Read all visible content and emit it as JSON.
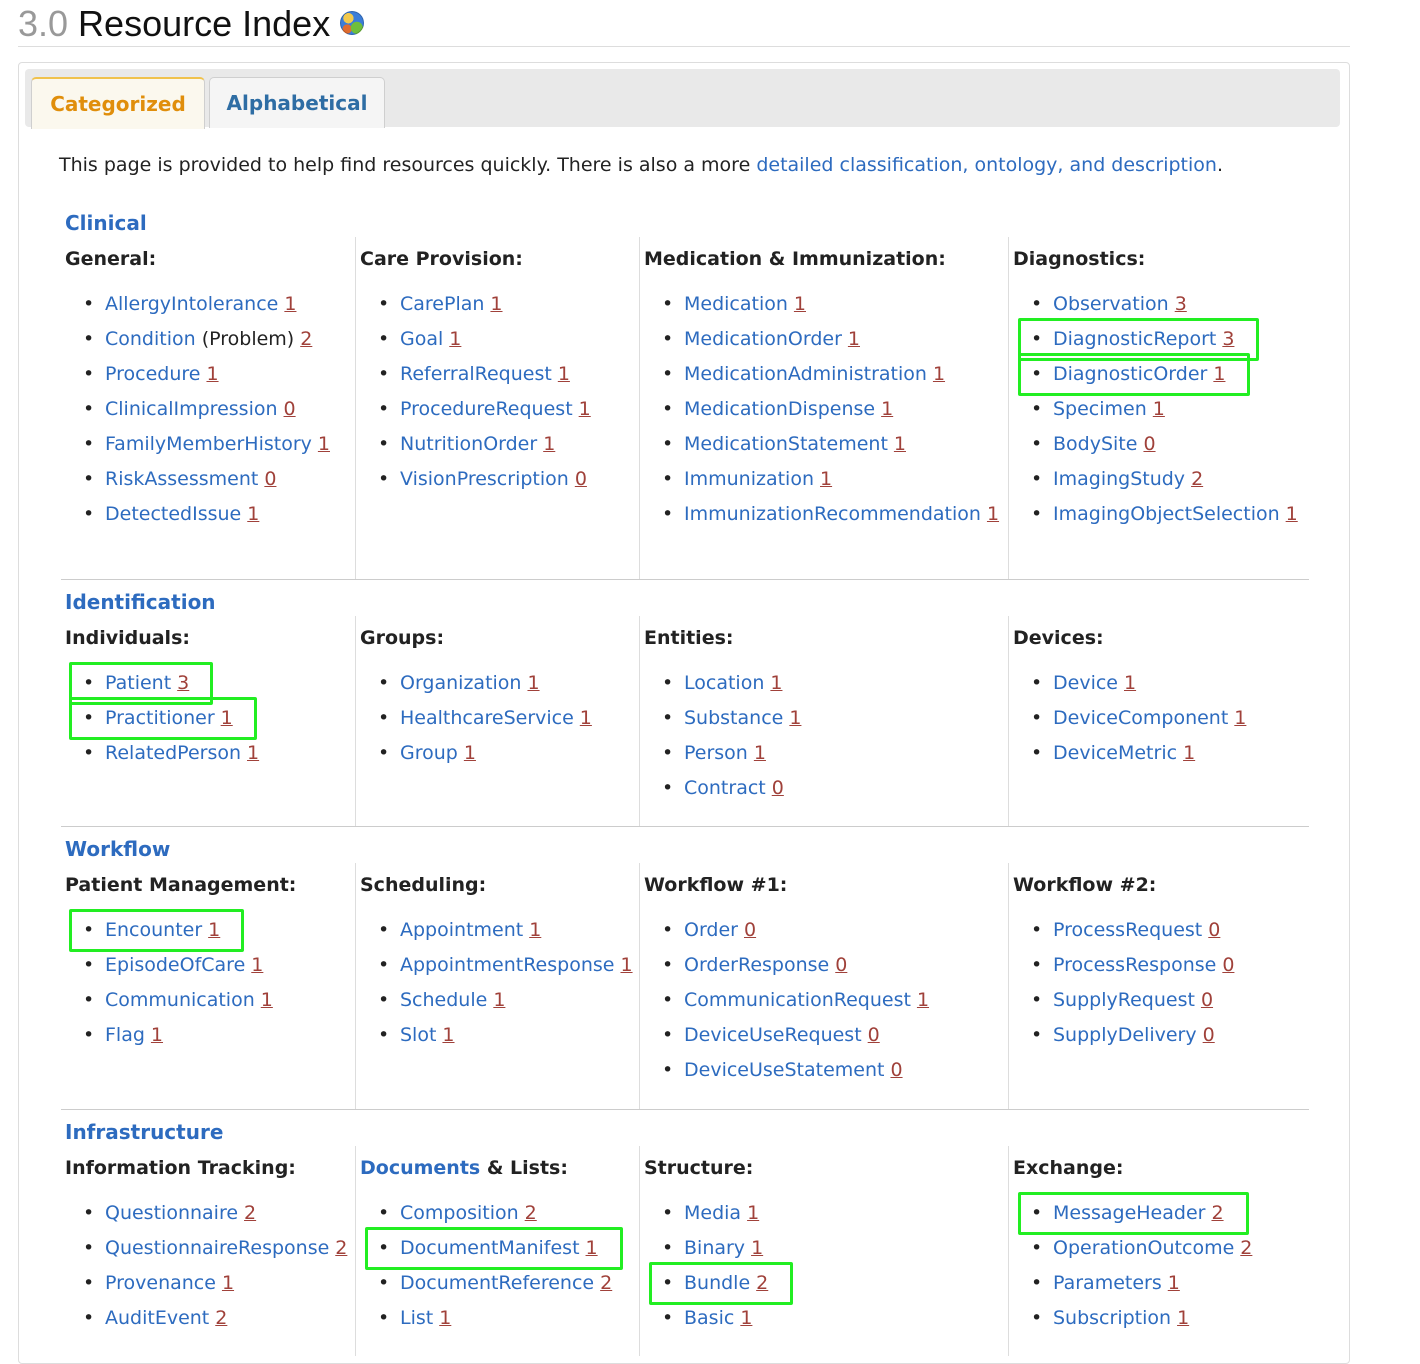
{
  "page": {
    "version": "3.0",
    "title": "Resource Index",
    "globe_icon": "globe-icon"
  },
  "tabs": [
    {
      "label": "Categorized",
      "active": true
    },
    {
      "label": "Alphabetical",
      "active": false
    }
  ],
  "intro": {
    "text": "This page is provided to help find resources quickly. There is also a more ",
    "link": "detailed classification, ontology, and description",
    "end": "."
  },
  "colors": {
    "link": "#2d6bbf",
    "count": "#a0413a",
    "active_tab": "#e08e0b",
    "highlight_box": "#22ee22"
  },
  "sections": [
    {
      "title": "Clinical",
      "columns": [
        {
          "heading": "General:",
          "items": [
            {
              "name": "AllergyIntolerance",
              "count": "1"
            },
            {
              "name": "Condition",
              "note": " (Problem)",
              "count": "2"
            },
            {
              "name": "Procedure",
              "count": "1"
            },
            {
              "name": "ClinicalImpression",
              "count": "0"
            },
            {
              "name": "FamilyMemberHistory",
              "count": "1"
            },
            {
              "name": "RiskAssessment",
              "count": "0"
            },
            {
              "name": "DetectedIssue",
              "count": "1"
            }
          ]
        },
        {
          "heading": "Care Provision:",
          "items": [
            {
              "name": "CarePlan",
              "count": "1"
            },
            {
              "name": "Goal",
              "count": "1"
            },
            {
              "name": "ReferralRequest",
              "count": "1"
            },
            {
              "name": "ProcedureRequest",
              "count": "1"
            },
            {
              "name": "NutritionOrder",
              "count": "1"
            },
            {
              "name": "VisionPrescription",
              "count": "0"
            }
          ]
        },
        {
          "heading": "Medication & Immunization:",
          "items": [
            {
              "name": "Medication",
              "count": "1"
            },
            {
              "name": "MedicationOrder",
              "count": "1"
            },
            {
              "name": "MedicationAdministration",
              "count": "1"
            },
            {
              "name": "MedicationDispense",
              "count": "1"
            },
            {
              "name": "MedicationStatement",
              "count": "1"
            },
            {
              "name": "Immunization",
              "count": "1"
            },
            {
              "name": "ImmunizationRecommendation",
              "count": "1"
            }
          ]
        },
        {
          "heading": "Diagnostics:",
          "items": [
            {
              "name": "Observation",
              "count": "3"
            },
            {
              "name": "DiagnosticReport",
              "count": "3",
              "highlighted": true
            },
            {
              "name": "DiagnosticOrder",
              "count": "1",
              "highlighted": true
            },
            {
              "name": "Specimen",
              "count": "1"
            },
            {
              "name": "BodySite",
              "count": "0"
            },
            {
              "name": "ImagingStudy",
              "count": "2"
            },
            {
              "name": "ImagingObjectSelection",
              "count": "1"
            }
          ]
        }
      ]
    },
    {
      "title": "Identification",
      "columns": [
        {
          "heading": "Individuals:",
          "items": [
            {
              "name": "Patient",
              "count": "3",
              "highlighted": true
            },
            {
              "name": "Practitioner",
              "count": "1",
              "highlighted": true
            },
            {
              "name": "RelatedPerson",
              "count": "1"
            }
          ]
        },
        {
          "heading": "Groups:",
          "items": [
            {
              "name": "Organization",
              "count": "1"
            },
            {
              "name": "HealthcareService",
              "count": "1"
            },
            {
              "name": "Group",
              "count": "1"
            }
          ]
        },
        {
          "heading": "Entities:",
          "items": [
            {
              "name": "Location",
              "count": "1"
            },
            {
              "name": "Substance",
              "count": "1"
            },
            {
              "name": "Person",
              "count": "1"
            },
            {
              "name": "Contract",
              "count": "0"
            }
          ]
        },
        {
          "heading": "Devices:",
          "items": [
            {
              "name": "Device",
              "count": "1"
            },
            {
              "name": "DeviceComponent",
              "count": "1"
            },
            {
              "name": "DeviceMetric",
              "count": "1"
            }
          ]
        }
      ]
    },
    {
      "title": "Workflow",
      "columns": [
        {
          "heading": "Patient Management:",
          "items": [
            {
              "name": "Encounter",
              "count": "1",
              "highlighted": true
            },
            {
              "name": "EpisodeOfCare",
              "count": "1"
            },
            {
              "name": "Communication",
              "count": "1"
            },
            {
              "name": "Flag",
              "count": "1"
            }
          ]
        },
        {
          "heading": "Scheduling:",
          "items": [
            {
              "name": "Appointment",
              "count": "1"
            },
            {
              "name": "AppointmentResponse",
              "count": "1"
            },
            {
              "name": "Schedule",
              "count": "1"
            },
            {
              "name": "Slot",
              "count": "1"
            }
          ]
        },
        {
          "heading": "Workflow #1:",
          "items": [
            {
              "name": "Order",
              "count": "0"
            },
            {
              "name": "OrderResponse",
              "count": "0"
            },
            {
              "name": "CommunicationRequest",
              "count": "1"
            },
            {
              "name": "DeviceUseRequest",
              "count": "0"
            },
            {
              "name": "DeviceUseStatement",
              "count": "0"
            }
          ]
        },
        {
          "heading": "Workflow #2:",
          "items": [
            {
              "name": "ProcessRequest",
              "count": "0"
            },
            {
              "name": "ProcessResponse",
              "count": "0"
            },
            {
              "name": "SupplyRequest",
              "count": "0"
            },
            {
              "name": "SupplyDelivery",
              "count": "0"
            }
          ]
        }
      ]
    },
    {
      "title": "Infrastructure",
      "columns": [
        {
          "heading": "Information Tracking:",
          "items": [
            {
              "name": "Questionnaire",
              "count": "2"
            },
            {
              "name": "QuestionnaireResponse",
              "count": "2"
            },
            {
              "name": "Provenance",
              "count": "1"
            },
            {
              "name": "AuditEvent",
              "count": "2"
            }
          ]
        },
        {
          "heading": "Documents",
          "heading_suffix": " & Lists:",
          "items": [
            {
              "name": "Composition",
              "count": "2"
            },
            {
              "name": "DocumentManifest",
              "count": "1",
              "highlighted": true
            },
            {
              "name": "DocumentReference",
              "count": "2"
            },
            {
              "name": "List",
              "count": "1"
            }
          ]
        },
        {
          "heading": "Structure:",
          "items": [
            {
              "name": "Media",
              "count": "1"
            },
            {
              "name": "Binary",
              "count": "1"
            },
            {
              "name": "Bundle",
              "count": "2",
              "highlighted": true
            },
            {
              "name": "Basic",
              "count": "1"
            }
          ]
        },
        {
          "heading": "Exchange:",
          "items": [
            {
              "name": "MessageHeader",
              "count": "2",
              "highlighted": true
            },
            {
              "name": "OperationOutcome",
              "count": "2"
            },
            {
              "name": "Parameters",
              "count": "1"
            },
            {
              "name": "Subscription",
              "count": "1"
            }
          ]
        }
      ]
    }
  ]
}
